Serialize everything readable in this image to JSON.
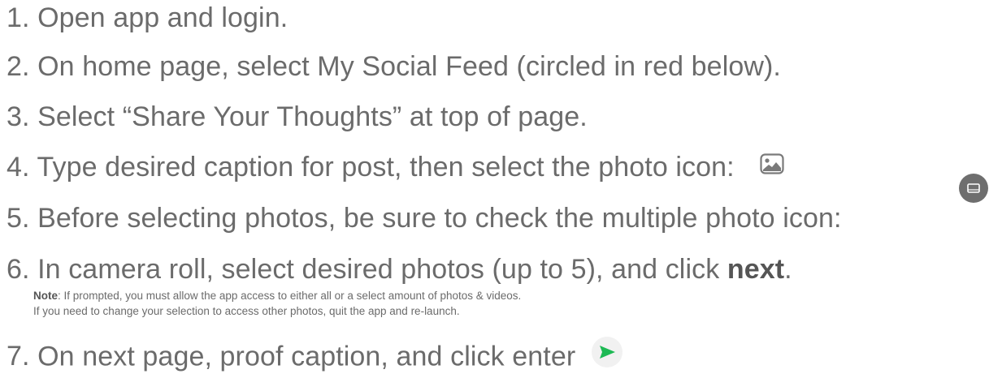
{
  "steps": [
    {
      "num": "1.",
      "text": "Open app and login."
    },
    {
      "num": "2.",
      "text": "On home page, select My Social Feed (circled in red below)."
    },
    {
      "num": "3.",
      "text": "Select “Share Your Thoughts” at top of page."
    },
    {
      "num": "4.",
      "text": "Type desired caption for post, then select the photo icon:"
    },
    {
      "num": "5.",
      "text": "Before selecting photos, be sure to check the multiple photo icon:"
    },
    {
      "num": "6.",
      "text": "In camera roll, select desired photos (up to 5), and click ",
      "bold": "next",
      "suffix": "."
    },
    {
      "num": "7.",
      "text": "On next page, proof caption, and click enter"
    }
  ],
  "note": {
    "label": "Note",
    "line1": ": If prompted, you must allow the app access to either all or a select amount of photos & videos.",
    "line2": "If you need to change your selection to access other photos, quit the app and re-launch."
  },
  "icons": {
    "photo": "photo-icon",
    "multiple_photo": "multiple-photo-icon",
    "send": "send-icon"
  },
  "colors": {
    "text": "#6b6b6b",
    "icon_gray": "#6e6e6e",
    "send_green": "#1db954"
  }
}
